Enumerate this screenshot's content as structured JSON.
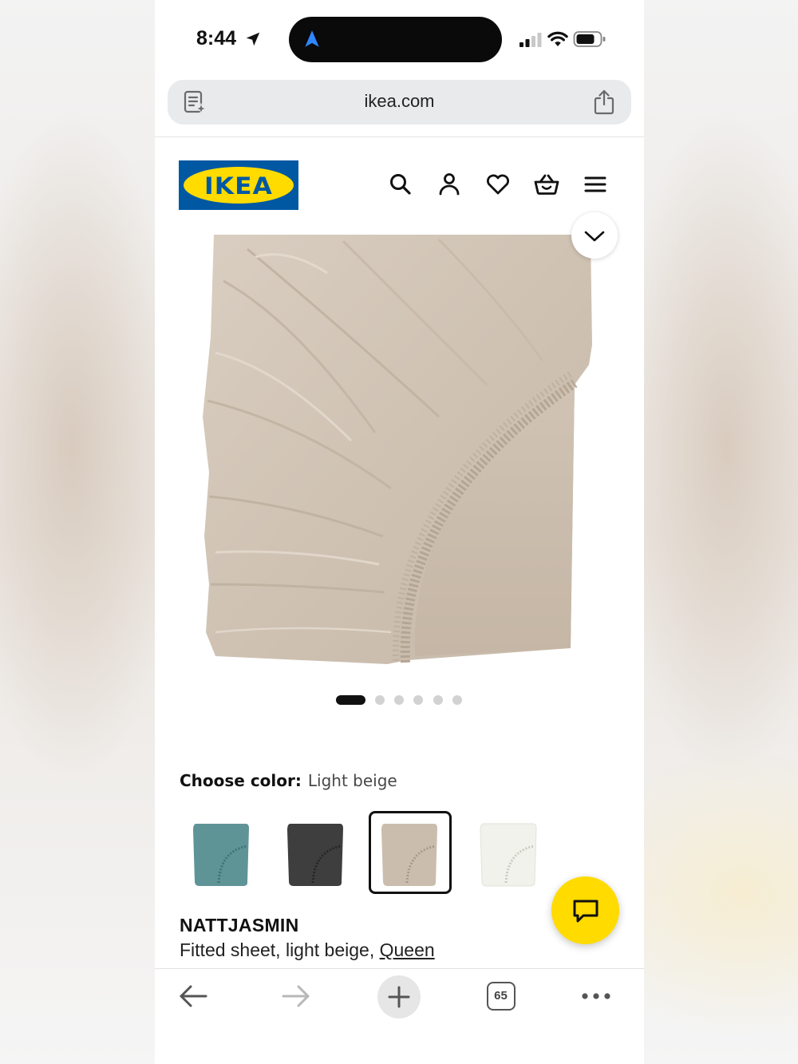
{
  "status_bar": {
    "time": "8:44",
    "icons": [
      "location-arrow-icon",
      "navigation-icon",
      "cellular-signal-icon",
      "wifi-icon",
      "battery-icon"
    ]
  },
  "browser": {
    "url": "ikea.com",
    "tab_count": "65"
  },
  "header": {
    "logo_text": "IKEA",
    "icons": [
      "search-icon",
      "account-icon",
      "heart-icon",
      "basket-icon",
      "menu-icon"
    ]
  },
  "gallery": {
    "image_count": 6,
    "active_index": 0
  },
  "color_chooser": {
    "label": "Choose color:",
    "selected_value": "Light beige",
    "swatches": [
      {
        "color": "#5f9497"
      },
      {
        "color": "#3e3e3f"
      },
      {
        "color": "#cbbdad"
      },
      {
        "color": "#f2f2ec"
      }
    ]
  },
  "product": {
    "name": "NATTJASMIN",
    "description": "Fitted sheet, light beige,",
    "size": "Queen"
  },
  "colors": {
    "ikea_blue": "#0058a3",
    "ikea_yellow": "#ffdb00"
  }
}
